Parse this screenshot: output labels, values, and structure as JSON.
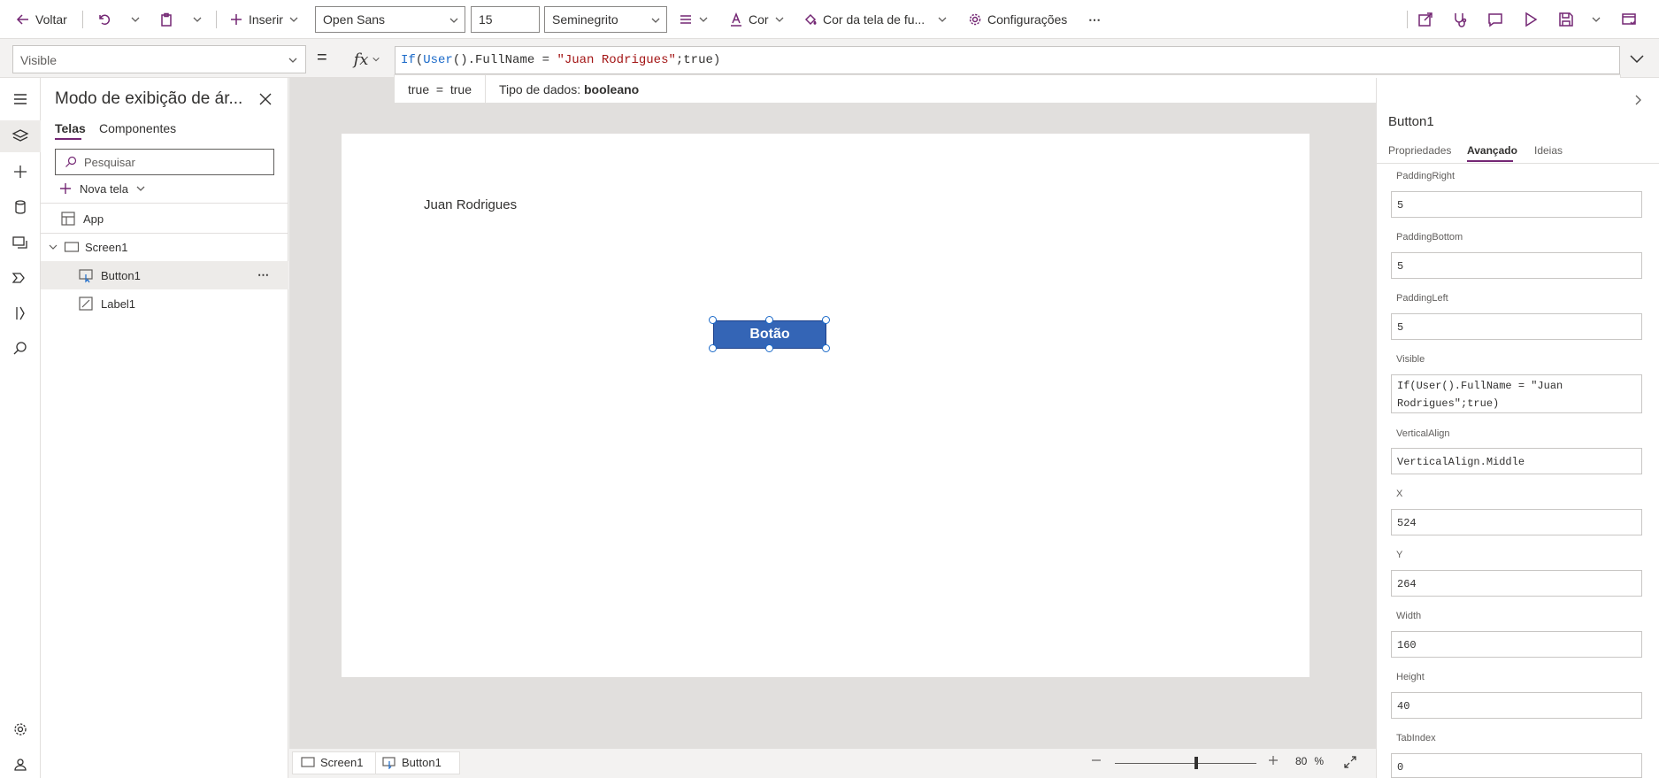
{
  "toolbar": {
    "back": "Voltar",
    "insert": "Inserir",
    "font": "Open Sans",
    "font_size": "15",
    "font_weight": "Seminegrito",
    "color": "Cor",
    "fill_color": "Cor da tela de fu...",
    "settings": "Configurações",
    "more": "⋯"
  },
  "formula_bar": {
    "property": "Visible",
    "equals": "=",
    "fx": "fx",
    "formula": {
      "fn1": "If",
      "p1": "(",
      "fn2": "User",
      "p2": "().FullName = ",
      "str": "\"Juan Rodrigues\"",
      "p3": ";true)"
    },
    "hint_result": "true  =  true",
    "hint_type_label": "Tipo de dados: ",
    "hint_type_value": "booleano"
  },
  "tree": {
    "title": "Modo de exibição de ár...",
    "tabs": [
      "Telas",
      "Componentes"
    ],
    "search_placeholder": "Pesquisar",
    "new_screen": "Nova tela",
    "items": [
      {
        "label": "App"
      },
      {
        "label": "Screen1"
      },
      {
        "label": "Button1",
        "more": "⋯"
      },
      {
        "label": "Label1"
      }
    ]
  },
  "canvas": {
    "label_text": "Juan Rodrigues",
    "button_text": "Botão"
  },
  "status": {
    "screen": "Screen1",
    "control": "Button1",
    "zoom": "80",
    "zoom_unit": "%",
    "zoom_level": 0.8
  },
  "props_panel": {
    "title": "Button1",
    "tabs": [
      "Propriedades",
      "Avançado",
      "Ideias"
    ],
    "fields": [
      {
        "label": "PaddingRight",
        "value": "5"
      },
      {
        "label": "PaddingBottom",
        "value": "5"
      },
      {
        "label": "PaddingLeft",
        "value": "5"
      },
      {
        "label": "Visible",
        "value": "If(User().FullName = \"Juan Rodrigues\";true)"
      },
      {
        "label": "VerticalAlign",
        "value": "VerticalAlign.Middle"
      },
      {
        "label": "X",
        "value": "524"
      },
      {
        "label": "Y",
        "value": "264"
      },
      {
        "label": "Width",
        "value": "160"
      },
      {
        "label": "Height",
        "value": "40"
      },
      {
        "label": "TabIndex",
        "value": "0"
      }
    ]
  },
  "colors": {
    "accent": "#742774",
    "button_fill": "#3465b6",
    "selection": "#1b6ac9"
  }
}
